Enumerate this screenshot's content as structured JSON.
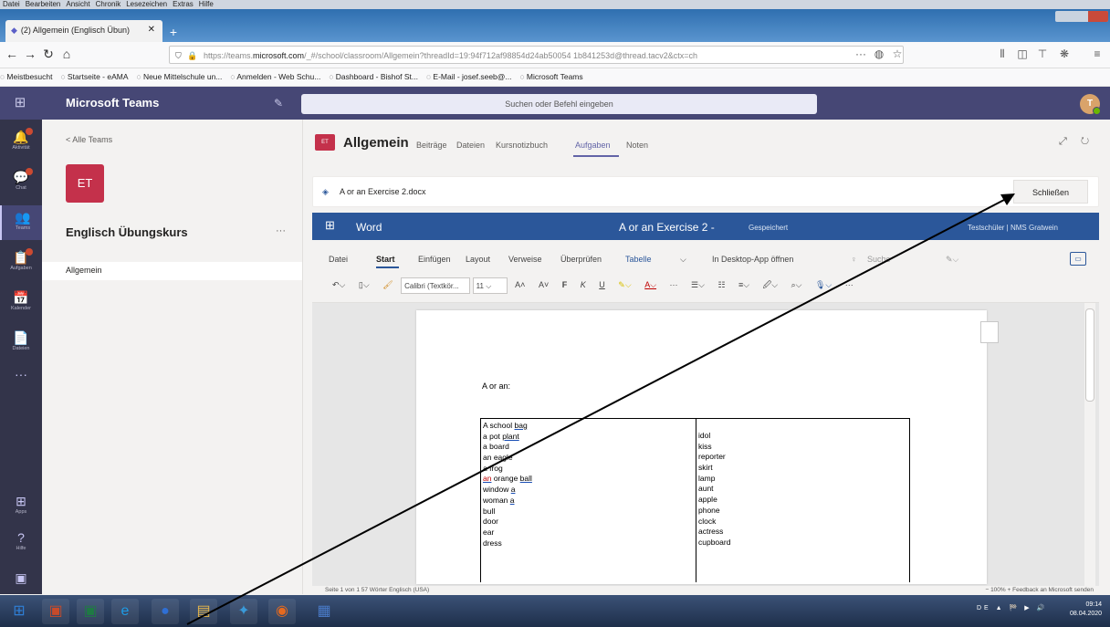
{
  "browser": {
    "menu": [
      "Datei",
      "Bearbeiten",
      "Ansicht",
      "Chronik",
      "Lesezeichen",
      "Extras",
      "Hilfe"
    ],
    "tab_title": "(2) Allgemein (Englisch Übun)",
    "url_prefix": "https://teams.",
    "url_domain": "microsoft.com",
    "url_rest": "/_#/school/classroom/Allgemein?threadId=19:94f712af98854d24ab50054 1b841253d@thread.tacv2&ctx=ch",
    "url_more": "···",
    "bookmarks": [
      "Meistbesucht",
      "Startseite - eAMA",
      "Neue Mittelschule un...",
      "Anmelden - Web Schu...",
      "Dashboard - Bishof St...",
      "E-Mail - josef.seeb@...",
      "Microsoft Teams"
    ]
  },
  "teams": {
    "app_title": "Microsoft Teams",
    "search_placeholder": "Suchen oder Befehl eingeben",
    "user_initial": "T",
    "rail": [
      {
        "icon": "bell-icon",
        "glyph": "🔔",
        "label": "Aktivität",
        "badge": true
      },
      {
        "icon": "chat-icon",
        "glyph": "💬",
        "label": "Chat",
        "badge": true
      },
      {
        "icon": "teams-icon",
        "glyph": "👥",
        "label": "Teams",
        "badge": false
      },
      {
        "icon": "assignments-icon",
        "glyph": "📋",
        "label": "Aufgaben",
        "badge": true
      },
      {
        "icon": "calendar-icon",
        "glyph": "📅",
        "label": "Kalender",
        "badge": false
      },
      {
        "icon": "files-icon",
        "glyph": "📄",
        "label": "Dateien",
        "badge": false
      }
    ],
    "rail_more": "···",
    "rail_apps": "Apps",
    "rail_help": "Hilfe",
    "back_label": "< Alle Teams",
    "team_initials": "ET",
    "team_name": "Englisch Übungskurs",
    "team_more": "···",
    "channel": "Allgemein",
    "channel_header": {
      "icon_text": "ET",
      "name": "Allgemein",
      "tabs": [
        "Beiträge",
        "Dateien",
        "Kursnotizbuch",
        "Aufgaben",
        "Noten"
      ]
    },
    "header_icons": "⤢ ↻"
  },
  "docbar": {
    "file_name": "A or an Exercise 2.docx",
    "close_label": "Schließen"
  },
  "word": {
    "app_label": "Word",
    "file_title": "A or an Exercise 2",
    "separator": "-",
    "saved": "Gespeichert",
    "user": "Testschüler | NMS Gratwein",
    "ribbon_tabs": [
      "Datei",
      "Start",
      "Einfügen",
      "Layout",
      "Verweise",
      "Überprüfen",
      "Tabelle",
      "In Desktop-App öffnen",
      "Suche"
    ],
    "font_name": "Calibri (Textkör...",
    "font_size": "11",
    "document": {
      "title": "A or an:",
      "left_column": [
        {
          "pre": "A school ",
          "u": "bag",
          "post": ""
        },
        {
          "pre": "a pot ",
          "u": "plant",
          "post": ""
        },
        {
          "pre": "a   board",
          "u": "",
          "post": ""
        },
        {
          "pre": "an  eagle",
          "u": "",
          "post": ""
        },
        {
          "pre": "a   frog",
          "u": "",
          "post": ""
        },
        {
          "pre": "",
          "red": "an",
          "pre2": " orange ",
          "u": "ball",
          "post": ""
        },
        {
          "pre": "window ",
          "u": "a",
          "post": ""
        },
        {
          "pre": "woman ",
          "u": "a",
          "post": ""
        },
        {
          "pre": "bull",
          "u": "",
          "post": ""
        },
        {
          "pre": "door",
          "u": "",
          "post": ""
        },
        {
          "pre": "ear",
          "u": "",
          "post": ""
        },
        {
          "pre": "dress",
          "u": "",
          "post": ""
        }
      ],
      "right_column": [
        "idol",
        "kiss",
        "reporter",
        "skirt",
        "lamp",
        "aunt",
        "apple",
        "phone",
        "clock",
        "actress",
        "cupboard"
      ]
    },
    "status_left": "Seite 1 von 1    57 Wörter    Englisch (USA)",
    "status_right": "−  100%  +    Feedback an Microsoft senden"
  },
  "taskbar": {
    "apps": [
      {
        "name": "start-orb-icon",
        "glyph": "⊞",
        "color": "#2f7fd6"
      },
      {
        "name": "powerpoint-taskbar-icon",
        "glyph": "▣",
        "color": "#c74b2b"
      },
      {
        "name": "excel-taskbar-icon",
        "glyph": "▣",
        "color": "#1f7a44"
      },
      {
        "name": "ie-taskbar-icon",
        "glyph": "e",
        "color": "#1d9be5"
      },
      {
        "name": "teams-taskbar-icon",
        "glyph": "●",
        "color": "#2f6fd4"
      },
      {
        "name": "folder-taskbar-icon",
        "glyph": "▤",
        "color": "#e8b84a"
      },
      {
        "name": "tool-taskbar-icon",
        "glyph": "✦",
        "color": "#3a9ad9"
      },
      {
        "name": "firefox-taskbar-icon",
        "glyph": "◉",
        "color": "#e66a1f"
      },
      {
        "name": "app-taskbar-icon",
        "glyph": "▦",
        "color": "#4a7bc8"
      }
    ],
    "tray": "DE ▲ 🏁 ▶ 🔊",
    "time": "09:14",
    "date": "08.04.2020"
  },
  "annotation": {
    "color": "#000000"
  }
}
